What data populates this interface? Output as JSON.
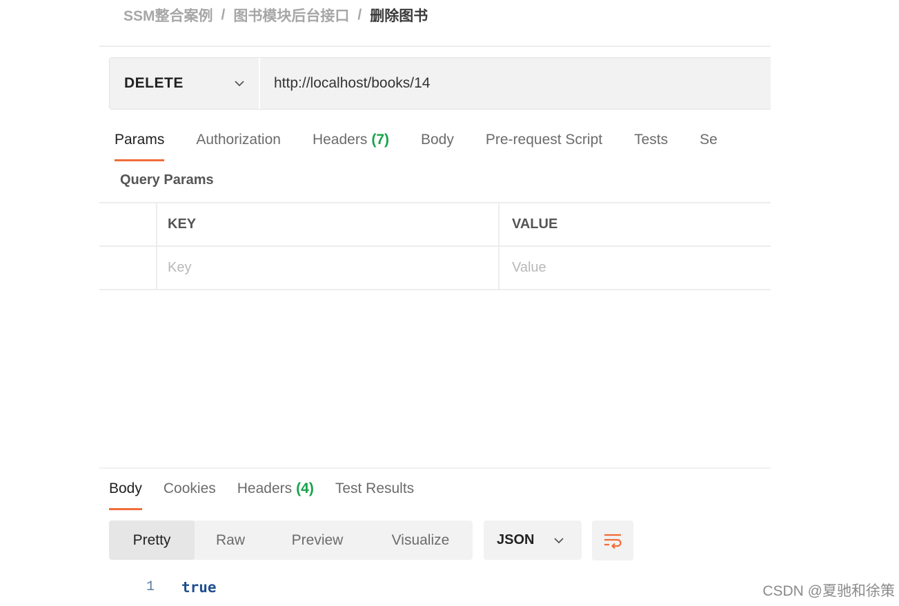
{
  "breadcrumb": {
    "items": [
      "SSM整合案例",
      "图书模块后台接口"
    ],
    "separator": "/",
    "current": "删除图书"
  },
  "request": {
    "method": "DELETE",
    "url": "http://localhost/books/14"
  },
  "request_tabs": [
    {
      "label": "Params",
      "count": "",
      "active": true
    },
    {
      "label": "Authorization",
      "count": ""
    },
    {
      "label": "Headers",
      "count": "(7)"
    },
    {
      "label": "Body",
      "count": ""
    },
    {
      "label": "Pre-request Script",
      "count": ""
    },
    {
      "label": "Tests",
      "count": ""
    },
    {
      "label": "Se",
      "count": ""
    }
  ],
  "query_params": {
    "title": "Query Params",
    "columns": [
      "KEY",
      "VALUE"
    ],
    "placeholders": {
      "key": "Key",
      "value": "Value"
    }
  },
  "response_tabs": [
    {
      "label": "Body",
      "count": "",
      "active": true
    },
    {
      "label": "Cookies",
      "count": ""
    },
    {
      "label": "Headers",
      "count": "(4)"
    },
    {
      "label": "Test Results",
      "count": ""
    }
  ],
  "view_modes": [
    "Pretty",
    "Raw",
    "Preview",
    "Visualize"
  ],
  "active_view_mode": "Pretty",
  "format": "JSON",
  "response_body": {
    "lines": [
      {
        "number": "1",
        "text": "true"
      }
    ]
  },
  "watermark": "CSDN @夏驰和徐策",
  "colors": {
    "accent": "#f26b3a",
    "count_green": "#16a34a",
    "json_value": "#1f4f8f"
  },
  "icons": {
    "method_dropdown": "chevron-down-icon",
    "format_dropdown": "chevron-down-icon",
    "wrap": "wrap-lines-icon"
  }
}
